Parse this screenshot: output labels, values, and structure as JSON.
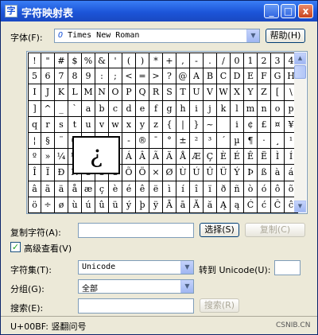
{
  "window": {
    "title": "字符映射表",
    "app_icon_glyph": "字",
    "min_glyph": "_",
    "max_glyph": "□",
    "close_glyph": "x"
  },
  "font": {
    "label": "字体(F):",
    "value": "Times New Roman",
    "prefix_icon": "O"
  },
  "help_button": "帮助(H)",
  "grid": {
    "rows": [
      [
        "!",
        "\"",
        "#",
        "$",
        "%",
        "&",
        "'",
        "(",
        ")",
        "*",
        "+",
        ",",
        "-",
        ".",
        "/",
        "0",
        "1",
        "2",
        "3",
        "4"
      ],
      [
        "5",
        "6",
        "7",
        "8",
        "9",
        ":",
        ";",
        "<",
        "=",
        ">",
        "?",
        "@",
        "A",
        "B",
        "C",
        "D",
        "E",
        "F",
        "G",
        "H"
      ],
      [
        "I",
        "J",
        "K",
        "L",
        "M",
        "N",
        "O",
        "P",
        "Q",
        "R",
        "S",
        "T",
        "U",
        "V",
        "W",
        "X",
        "Y",
        "Z",
        "[",
        "\\"
      ],
      [
        "]",
        "^",
        "_",
        "`",
        "a",
        "b",
        "c",
        "d",
        "e",
        "f",
        "g",
        "h",
        "i",
        "j",
        "k",
        "l",
        "m",
        "n",
        "o",
        "p"
      ],
      [
        "q",
        "r",
        "s",
        "t",
        "u",
        "v",
        "w",
        "x",
        "y",
        "z",
        "{",
        "|",
        "}",
        "~",
        "",
        "i",
        "¢",
        "£",
        "¤",
        "¥"
      ],
      [
        "¦",
        "§",
        "¨",
        "©",
        "ª",
        "«",
        "¬",
        "-",
        "®",
        "¯",
        "°",
        "±",
        "²",
        "³",
        "´",
        "µ",
        "¶",
        "·",
        "¸",
        "¹"
      ],
      [
        "º",
        "»",
        "¼",
        "½",
        "¾",
        "¿",
        "À",
        "Á",
        "Â",
        "Ã",
        "Ä",
        "Å",
        "Æ",
        "Ç",
        "È",
        "É",
        "Ê",
        "Ë",
        "Ì",
        "Í"
      ],
      [
        "Î",
        "Ï",
        "Ð",
        "Ñ",
        "Ò",
        "Ó",
        "Ô",
        "Õ",
        "Ö",
        "×",
        "Ø",
        "Ù",
        "Ú",
        "Û",
        "Ü",
        "Ý",
        "Þ",
        "ß",
        "à",
        "á"
      ],
      [
        "â",
        "ã",
        "ä",
        "å",
        "æ",
        "ç",
        "è",
        "é",
        "ê",
        "ë",
        "ì",
        "í",
        "î",
        "ï",
        "ð",
        "ñ",
        "ò",
        "ó",
        "ô",
        "õ"
      ],
      [
        "ö",
        "÷",
        "ø",
        "ù",
        "ú",
        "û",
        "ü",
        "ý",
        "þ",
        "ÿ",
        "Ā",
        "ā",
        "Ă",
        "ă",
        "Ą",
        "ą",
        "Ć",
        "ć",
        "Ĉ",
        "ĉ"
      ]
    ],
    "selected_char": "¿"
  },
  "copy": {
    "label": "复制字符(A):",
    "value": "",
    "select_button": "选择(S)",
    "copy_button": "复制(C)"
  },
  "advanced": {
    "label": "高级查看(V)",
    "checked": true
  },
  "charset": {
    "label": "字符集(T):",
    "value": "Unicode",
    "goto_label": "转到 Unicode(U):",
    "goto_value": ""
  },
  "group": {
    "label": "分组(G):",
    "value": "全部"
  },
  "search": {
    "label": "搜索(E):",
    "value": "",
    "button": "搜索(R)"
  },
  "status": "U+00BF: 竖翻问号",
  "watermark": "CSNIB.CN"
}
